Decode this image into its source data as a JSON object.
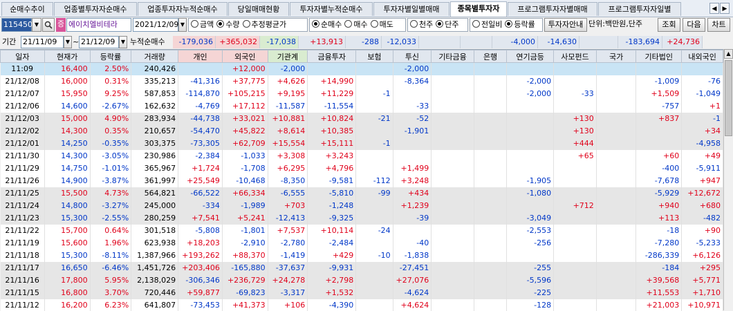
{
  "tabs": [
    "순매수추이",
    "업종별투자자순매수",
    "업종투자자누적순매수",
    "당일매매현황",
    "투자자별누적순매수",
    "투자자별일별매매",
    "종목별투자자",
    "프로그램투자자별매매",
    "프로그램투자자일별"
  ],
  "active_tab": 6,
  "toolbar": {
    "code": "115450",
    "stock_badge": "증",
    "stock_name": "에이치엘비테라",
    "date": "2021/12/09",
    "radio_group1": [
      {
        "label": "금액",
        "on": false
      },
      {
        "label": "수량",
        "on": true
      },
      {
        "label": "추정평균가",
        "on": false
      }
    ],
    "radio_group2": [
      {
        "label": "순매수",
        "on": true
      },
      {
        "label": "매수",
        "on": false
      },
      {
        "label": "매도",
        "on": false
      }
    ],
    "radio_group3": [
      {
        "label": "천주",
        "on": false
      },
      {
        "label": "단주",
        "on": true
      }
    ],
    "radio_group4": [
      {
        "label": "전일비",
        "on": false
      },
      {
        "label": "등락률",
        "on": true
      }
    ],
    "investor_info_button": "투자자안내",
    "unit_label": "단위:백만원,단주",
    "query_button": "조회",
    "next_button": "다음",
    "chart_button": "차트"
  },
  "period": {
    "label": "기간",
    "from": "21/11/09",
    "sep": "~",
    "to": "21/12/09",
    "cum_label": "누적순매수",
    "cum_values": [
      "-179,036",
      "+365,032",
      "-17,038",
      "+13,913",
      "-288",
      "-12,033",
      "",
      "",
      "-4,000",
      "-14,630",
      "",
      "-183,694",
      "+24,736"
    ]
  },
  "columns": [
    "일자",
    "현재가",
    "등락률",
    "거래량",
    "개인",
    "외국인",
    "기관계",
    "금융투자",
    "보험",
    "투신",
    "기타금융",
    "은행",
    "연기금등",
    "사모펀드",
    "국가",
    "기타법인",
    "내외국인"
  ],
  "rows": [
    [
      "11:09",
      "16,400",
      "2.50%",
      "240,426",
      "",
      "+12,000",
      "-2,000",
      "",
      "",
      "-2,000",
      "",
      "",
      "",
      "",
      "",
      "",
      ""
    ],
    [
      "21/12/08",
      "16,000",
      "0.31%",
      "335,213",
      "-41,316",
      "+37,775",
      "+4,626",
      "+14,990",
      "",
      "-8,364",
      "",
      "",
      "-2,000",
      "",
      "",
      "-1,009",
      "-76"
    ],
    [
      "21/12/07",
      "15,950",
      "9.25%",
      "587,853",
      "-114,870",
      "+105,215",
      "+9,195",
      "+11,229",
      "-1",
      "",
      "",
      "",
      "-2,000",
      "-33",
      "",
      "+1,509",
      "-1,049"
    ],
    [
      "21/12/06",
      "14,600",
      "-2.67%",
      "162,632",
      "-4,769",
      "+17,112",
      "-11,587",
      "-11,554",
      "",
      "-33",
      "",
      "",
      "",
      "",
      "",
      "-757",
      "+1"
    ],
    [
      "21/12/03",
      "15,000",
      "4.90%",
      "283,934",
      "-44,738",
      "+33,021",
      "+10,881",
      "+10,824",
      "-21",
      "-52",
      "",
      "",
      "",
      "+130",
      "",
      "+837",
      "-1"
    ],
    [
      "21/12/02",
      "14,300",
      "0.35%",
      "210,657",
      "-54,470",
      "+45,822",
      "+8,614",
      "+10,385",
      "",
      "-1,901",
      "",
      "",
      "",
      "+130",
      "",
      "",
      "+34"
    ],
    [
      "21/12/01",
      "14,250",
      "-0.35%",
      "303,375",
      "-73,305",
      "+62,709",
      "+15,554",
      "+15,111",
      "-1",
      "",
      "",
      "",
      "",
      "+444",
      "",
      "",
      "-4,958"
    ],
    [
      "21/11/30",
      "14,300",
      "-3.05%",
      "230,986",
      "-2,384",
      "-1,033",
      "+3,308",
      "+3,243",
      "",
      "",
      "",
      "",
      "",
      "+65",
      "",
      "+60",
      "+49"
    ],
    [
      "21/11/29",
      "14,750",
      "-1.01%",
      "365,967",
      "+1,724",
      "-1,708",
      "+6,295",
      "+4,796",
      "",
      "+1,499",
      "",
      "",
      "",
      "",
      "",
      "-400",
      "-5,911"
    ],
    [
      "21/11/26",
      "14,900",
      "-3.87%",
      "361,997",
      "+25,549",
      "-10,468",
      "-8,350",
      "-9,581",
      "-112",
      "+3,248",
      "",
      "",
      "-1,905",
      "",
      "",
      "-7,678",
      "+947"
    ],
    [
      "21/11/25",
      "15,500",
      "4.73%",
      "564,821",
      "-66,522",
      "+66,334",
      "-6,555",
      "-5,810",
      "-99",
      "+434",
      "",
      "",
      "-1,080",
      "",
      "",
      "-5,929",
      "+12,672"
    ],
    [
      "21/11/24",
      "14,800",
      "-3.27%",
      "245,000",
      "-334",
      "-1,989",
      "+703",
      "-1,248",
      "",
      "+1,239",
      "",
      "",
      "",
      "+712",
      "",
      "+940",
      "+680"
    ],
    [
      "21/11/23",
      "15,300",
      "-2.55%",
      "280,259",
      "+7,541",
      "+5,241",
      "-12,413",
      "-9,325",
      "",
      "-39",
      "",
      "",
      "-3,049",
      "",
      "",
      "+113",
      "-482"
    ],
    [
      "21/11/22",
      "15,700",
      "0.64%",
      "301,518",
      "-5,808",
      "-1,801",
      "+7,537",
      "+10,114",
      "-24",
      "",
      "",
      "",
      "-2,553",
      "",
      "",
      "-18",
      "+90"
    ],
    [
      "21/11/19",
      "15,600",
      "1.96%",
      "623,938",
      "+18,203",
      "-2,910",
      "-2,780",
      "-2,484",
      "",
      "-40",
      "",
      "",
      "-256",
      "",
      "",
      "-7,280",
      "-5,233"
    ],
    [
      "21/11/18",
      "15,300",
      "-8.11%",
      "1,387,966",
      "+193,262",
      "+88,370",
      "-1,419",
      "+429",
      "-10",
      "-1,838",
      "",
      "",
      "",
      "",
      "",
      "-286,339",
      "+6,126"
    ],
    [
      "21/11/17",
      "16,650",
      "-6.46%",
      "1,451,726",
      "+203,406",
      "-165,880",
      "-37,637",
      "-9,931",
      "",
      "-27,451",
      "",
      "",
      "-255",
      "",
      "",
      "-184",
      "+295"
    ],
    [
      "21/11/16",
      "17,800",
      "5.95%",
      "2,138,029",
      "-306,346",
      "+236,729",
      "+24,278",
      "+2,798",
      "",
      "+27,076",
      "",
      "",
      "-5,596",
      "",
      "",
      "+39,568",
      "+5,771"
    ],
    [
      "21/11/15",
      "16,800",
      "3.70%",
      "720,446",
      "+59,877",
      "-69,823",
      "-3,317",
      "+1,532",
      "",
      "-4,624",
      "",
      "",
      "-225",
      "",
      "",
      "+11,553",
      "+1,710"
    ],
    [
      "21/11/12",
      "16,200",
      "6.23%",
      "641,807",
      "-73,453",
      "+41,373",
      "+106",
      "-4,390",
      "",
      "+4,624",
      "",
      "",
      "-128",
      "",
      "",
      "+21,003",
      "+10,971"
    ]
  ],
  "colors": {
    "up": "#e0001a",
    "down": "#0037c8",
    "highlight_row": "#c9e4f5"
  }
}
